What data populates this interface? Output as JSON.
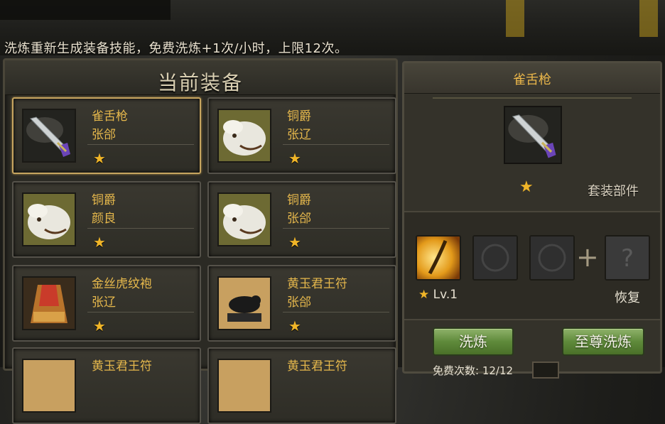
{
  "header": {
    "info_text": "洗炼重新生成装备技能，免费洗炼+1次/小时，上限12次。"
  },
  "left_panel": {
    "title": "当前装备",
    "cards": [
      {
        "name": "雀舌枪",
        "owner": "张郃",
        "stars": "★",
        "icon": "spear-icon",
        "selected": true
      },
      {
        "name": "铜爵",
        "owner": "张辽",
        "stars": "★",
        "icon": "white-horse-icon",
        "selected": false
      },
      {
        "name": "铜爵",
        "owner": "颜良",
        "stars": "★",
        "icon": "white-horse-icon",
        "selected": false
      },
      {
        "name": "铜爵",
        "owner": "张郃",
        "stars": "★",
        "icon": "white-horse-icon",
        "selected": false
      },
      {
        "name": "金丝虎纹袍",
        "owner": "张辽",
        "stars": "★",
        "icon": "robe-icon",
        "selected": false
      },
      {
        "name": "黄玉君王符",
        "owner": "张郃",
        "stars": "★",
        "icon": "tiger-talisman-icon",
        "selected": false
      },
      {
        "name": "黄玉君王符",
        "owner": "",
        "stars": "",
        "icon": "tiger-talisman-icon",
        "selected": false
      },
      {
        "name": "黄玉君王符",
        "owner": "",
        "stars": "",
        "icon": "tiger-talisman-icon",
        "selected": false
      }
    ]
  },
  "right_panel": {
    "title": "雀舌枪",
    "item_star": "★",
    "set_label": "套装部件",
    "skill_level": "Lv.1",
    "skill_star": "★",
    "plus": "+",
    "restore_label": "恢复",
    "refine_button": "洗炼",
    "supreme_refine_button": "至尊洗炼",
    "bottom_text": "免费次数: 12/12"
  },
  "colors": {
    "gold_text": "#e6b84c",
    "star": "#f0b528",
    "button_green": "#6f9a47",
    "selected_border": "#c7a560"
  }
}
